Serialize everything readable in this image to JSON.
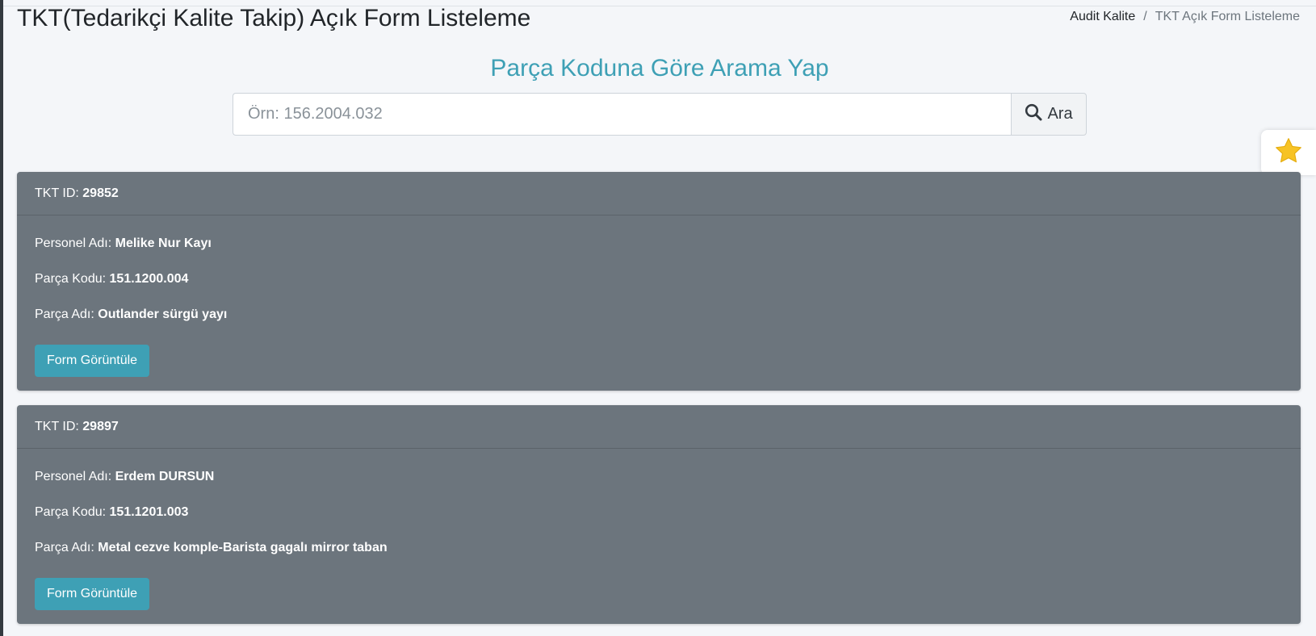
{
  "page": {
    "title": "TKT(Tedarikçi Kalite Takip) Açık Form Listeleme"
  },
  "breadcrumb": {
    "items": [
      "Audit Kalite",
      "TKT Açık Form Listeleme"
    ],
    "separator": "/"
  },
  "search": {
    "heading": "Parça Koduna Göre Arama Yap",
    "placeholder": "Örn: 156.2004.032",
    "value": "",
    "button_label": "Ara",
    "button_icon": "search-icon"
  },
  "favorites": {
    "icon": "star-icon",
    "color": "#f7c325"
  },
  "labels": {
    "tkt_id": "TKT ID:",
    "personel": "Personel Adı:",
    "parca_kodu": "Parça Kodu:",
    "parca_adi": "Parça Adı:",
    "form_button": "Form Görüntüle"
  },
  "forms": [
    {
      "tkt_id": "29852",
      "personel": "Melike Nur Kayı",
      "parca_kodu": "151.1200.004",
      "parca_adi": "Outlander sürgü yayı"
    },
    {
      "tkt_id": "29897",
      "personel": "Erdem DURSUN",
      "parca_kodu": "151.1201.003",
      "parca_adi": "Metal cezve komple-Barista gagalı mirror taban"
    }
  ],
  "colors": {
    "accent": "#3ea0b5",
    "card_bg": "#6c757d",
    "page_bg": "#f4f6f9"
  }
}
